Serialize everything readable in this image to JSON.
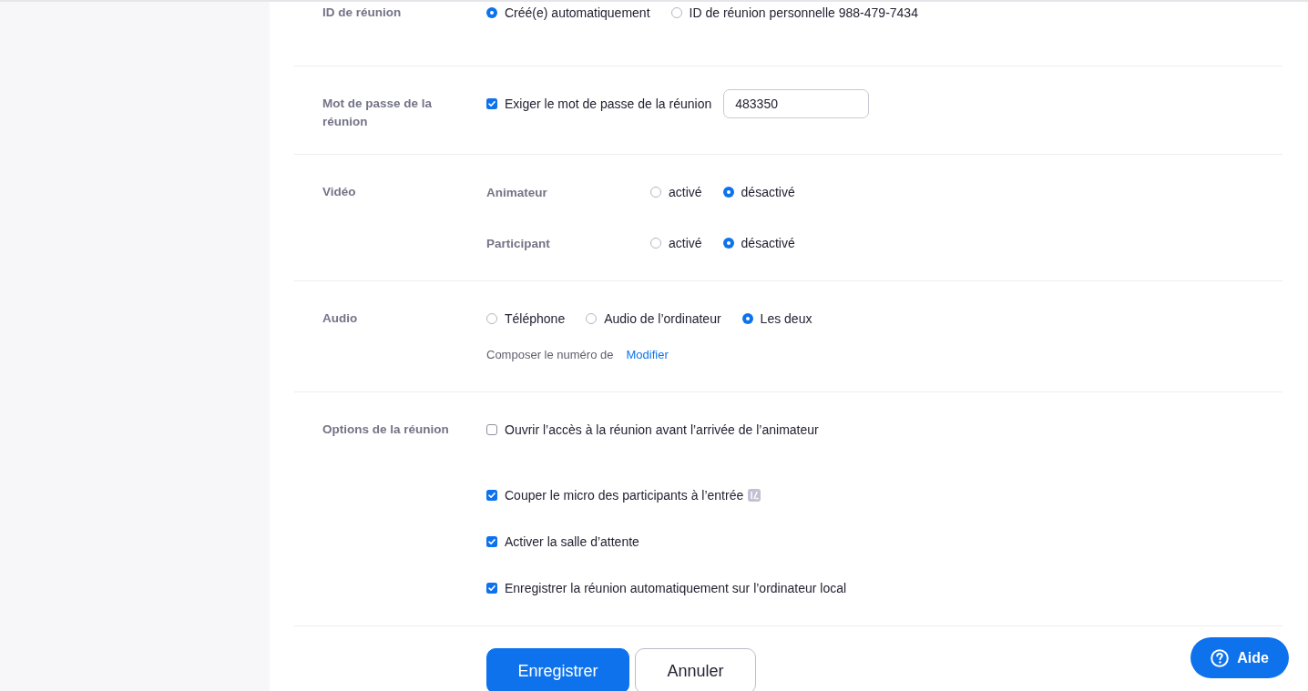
{
  "sections": [
    {
      "label": "ID de réunion",
      "rows": [
        {
          "kind": "radios",
          "options": [
            {
              "label": "Créé(e) automatiquement",
              "selected": true
            },
            {
              "label": "ID de réunion personnelle 988-479-7434",
              "selected": false
            }
          ]
        }
      ]
    },
    {
      "label": "Mot de passe de la réunion",
      "rows": [
        {
          "kind": "checkbox",
          "label": "Exiger le mot de passe de la réunion",
          "checked": true,
          "field": {
            "value": "483350"
          }
        }
      ]
    },
    {
      "label": "Vidéo",
      "rows": [
        {
          "kind": "radios",
          "label": "Animateur",
          "options": [
            {
              "label": "activé",
              "selected": false
            },
            {
              "label": "désactivé",
              "selected": true
            }
          ]
        },
        {
          "kind": "radios",
          "label": "Participant",
          "options": [
            {
              "label": "activé",
              "selected": false
            },
            {
              "label": "désactivé",
              "selected": true
            }
          ]
        }
      ]
    },
    {
      "label": "Audio",
      "rows": [
        {
          "kind": "radios",
          "options": [
            {
              "label": "Téléphone",
              "selected": false
            },
            {
              "label": "Audio de l’ordinateur",
              "selected": false
            },
            {
              "label": "Les deux",
              "selected": true
            }
          ]
        },
        {
          "kind": "note",
          "text": "Composer le numéro de",
          "link": "Modifier"
        }
      ]
    },
    {
      "label": "Options de la réunion",
      "rows": [
        {
          "kind": "checkbox",
          "label": "Ouvrir l’accès à la réunion avant l’arrivée de l’animateur",
          "checked": false
        },
        {
          "kind": "checkbox",
          "label": "Couper le micro des participants à l’entrée",
          "checked": true,
          "badge": true
        },
        {
          "kind": "checkbox",
          "label": "Activer la salle d’attente",
          "checked": true
        },
        {
          "kind": "checkbox",
          "label": "Enregistrer la réunion automatiquement sur l’ordinateur local",
          "checked": true
        }
      ]
    }
  ],
  "buttons": [
    {
      "label": "Enregistrer",
      "kind": "primary"
    },
    {
      "label": "Annuler",
      "kind": "secondary"
    }
  ],
  "help_button": {
    "label": "Aide"
  }
}
